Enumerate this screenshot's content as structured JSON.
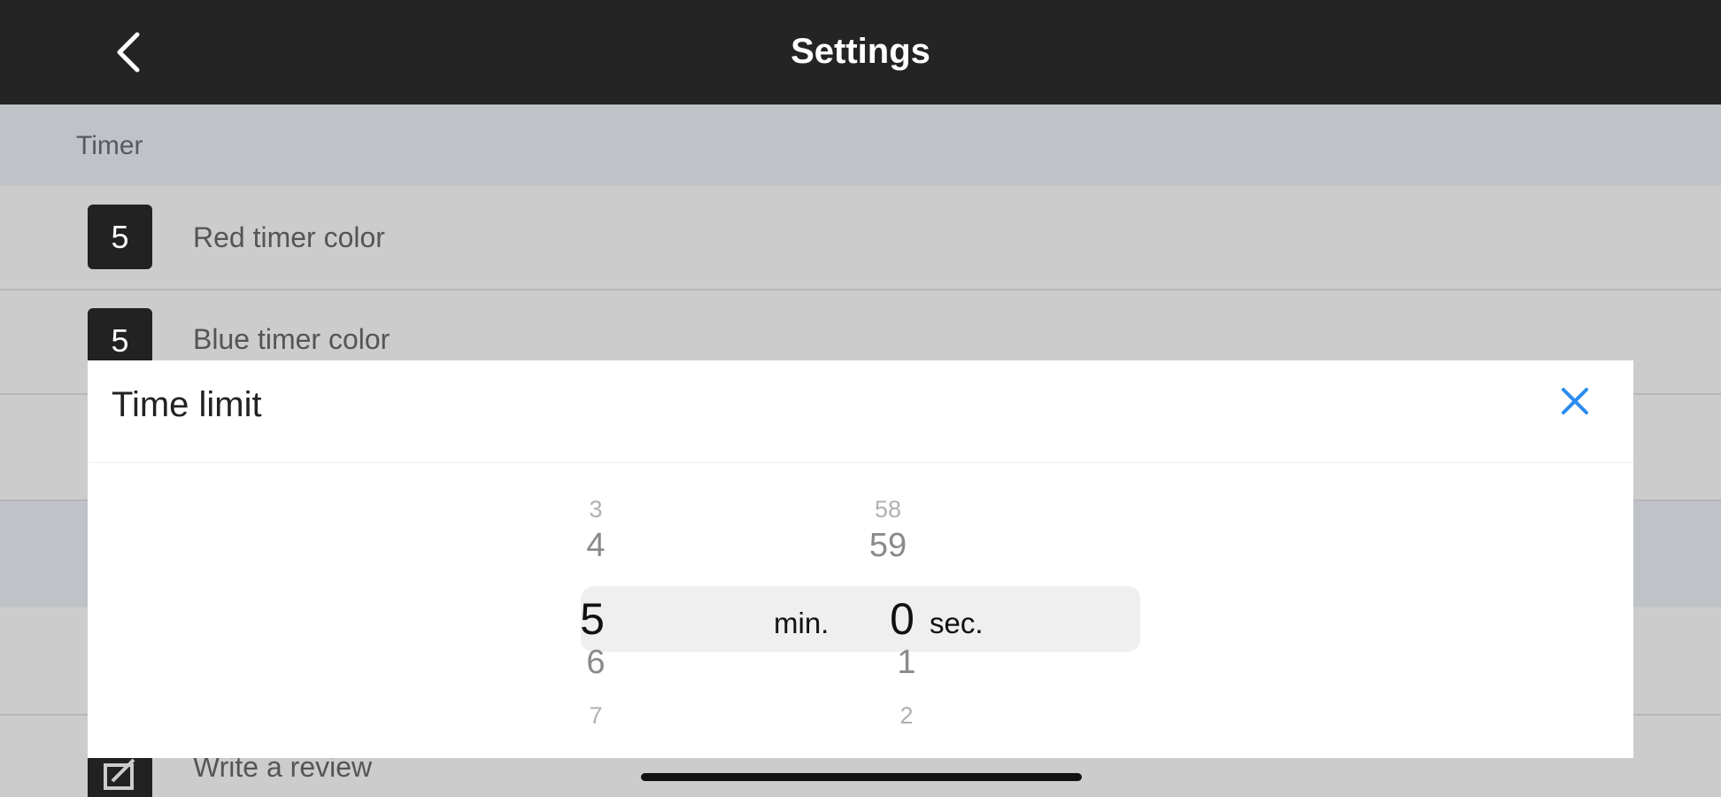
{
  "navbar": {
    "title": "Settings",
    "back_icon": "chevron-left-icon"
  },
  "settings": {
    "section_timer": "Timer",
    "red_timer": {
      "badge": "5",
      "label": "Red timer color"
    },
    "blue_timer": {
      "badge": "5",
      "label": "Blue timer color"
    },
    "review": {
      "label": "Write a review",
      "icon": "compose-icon"
    }
  },
  "modal": {
    "title": "Time limit",
    "close_icon": "close-icon",
    "accent_color": "#2a8cf0",
    "minutes": {
      "selected": "5",
      "unit": "min.",
      "above": [
        "3",
        "4"
      ],
      "below": [
        "6",
        "7"
      ]
    },
    "seconds": {
      "selected": "0",
      "unit": "sec.",
      "above": [
        "58",
        "59"
      ],
      "below": [
        "1",
        "2"
      ]
    }
  }
}
